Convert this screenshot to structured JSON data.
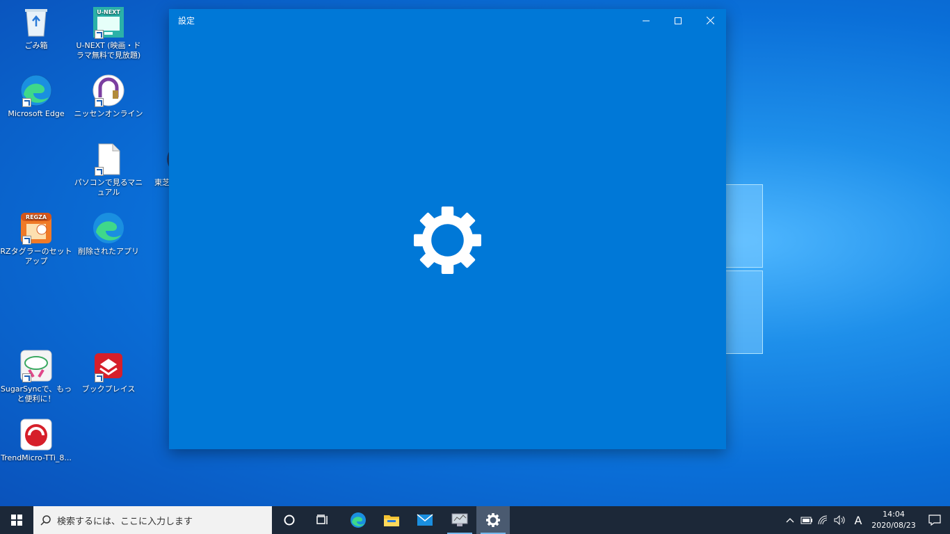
{
  "desktop": {
    "icons": [
      {
        "label": "ごみ箱"
      },
      {
        "label": "U-NEXT (映画・ドラマ無料で見放題)"
      },
      {
        "label": "Microsoft Edge"
      },
      {
        "label": "ニッセンオンライン"
      },
      {
        "label": "パソコンで見るマニュアル"
      },
      {
        "label": "東芝"
      },
      {
        "label": "RZタグラーのセットアップ"
      },
      {
        "label": "削除されたアプリ"
      },
      {
        "label": "SugarSyncで、もっと便利に！"
      },
      {
        "label": "ブックプレイス"
      },
      {
        "label": "TrendMicro-TTi_8..."
      }
    ],
    "unext_logo_text": "U-NEXT",
    "regza_logo_text": "REGZA"
  },
  "window": {
    "title": "設定",
    "controls": {
      "minimize": "—",
      "maximize": "☐",
      "close": "✕"
    }
  },
  "taskbar": {
    "search_placeholder": "検索するには、ここに入力します",
    "ime_indicator": "A",
    "time": "14:04",
    "date": "2020/08/23"
  },
  "colors": {
    "window_bg": "#0078d7",
    "taskbar_bg": "#1c2838",
    "accent": "#76b9ed"
  }
}
